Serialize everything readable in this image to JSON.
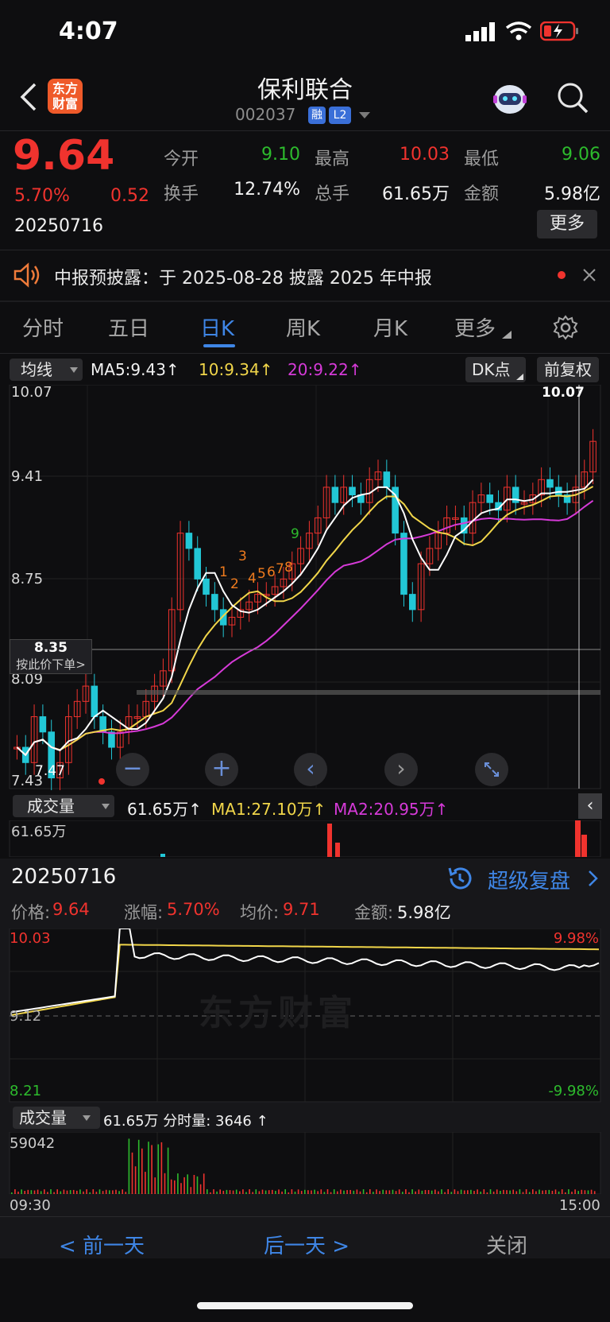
{
  "status": {
    "time": "4:07"
  },
  "header": {
    "title": "保利联合",
    "code": "002037",
    "tag_rong": "融",
    "tag_l2": "L2",
    "logo_line1": "东方",
    "logo_line2": "财富"
  },
  "quote": {
    "price": "9.64",
    "change_pct": "5.70%",
    "change": "0.52",
    "date": "20250716",
    "open_label": "今开",
    "open": "9.10",
    "high_label": "最高",
    "high": "10.03",
    "low_label": "最低",
    "low": "9.06",
    "turnover_label": "换手",
    "turnover": "12.74%",
    "volume_label": "总手",
    "volume": "61.65万",
    "amount_label": "金额",
    "amount": "5.98亿",
    "more_button": "更多"
  },
  "notice": {
    "text": "中报预披露：于 2025-08-28 披露 2025 年中报"
  },
  "tabs": [
    {
      "label": "分时"
    },
    {
      "label": "五日"
    },
    {
      "label": "日K"
    },
    {
      "label": "周K"
    },
    {
      "label": "月K"
    },
    {
      "label": "更多"
    }
  ],
  "kline": {
    "indicator": "均线",
    "ma5": "MA5:9.43↑",
    "ma10": "10:9.34↑",
    "ma20": "20:9.22↑",
    "dk": "DK点",
    "adjust": "前复权",
    "axis": [
      "10.07",
      "9.41",
      "8.75",
      "8.09",
      "7.43"
    ],
    "high_marker": "10.07",
    "low_marker": "7.47",
    "order_price": "8.35",
    "order_hint": "按此价下单>",
    "signals": [
      "1",
      "2",
      "3",
      "4",
      "5",
      "6",
      "7",
      "8",
      "9"
    ]
  },
  "volume": {
    "label": "成交量",
    "value": "61.65万↑",
    "ma1": "MA1:27.10万↑",
    "ma2": "MA2:20.95万↑",
    "axis_top": "61.65万"
  },
  "replay": {
    "date": "20250716",
    "link": "超级复盘",
    "price_label": "价格:",
    "price": "9.64",
    "pct_label": "涨幅:",
    "pct": "5.70%",
    "avg_label": "均价:",
    "avg": "9.71",
    "amount_label": "金额:",
    "amount": "5.98亿"
  },
  "intraday": {
    "axis_high": "10.03",
    "axis_mid": "9.12",
    "axis_low": "8.21",
    "pct_high": "9.98%",
    "pct_low": "-9.98%",
    "watermark": "东方财富",
    "vol_label": "成交量",
    "vol_text": "61.65万 分时量: 3646 ↑",
    "vol_axis": "59042",
    "time_start": "09:30",
    "time_end": "15:00"
  },
  "footer": {
    "prev": "< 前一天",
    "next": "后一天 >",
    "close": "关闭"
  },
  "colors": {
    "up": "#f0332e",
    "down": "#22c7d6",
    "ma5": "#ffffff",
    "ma10": "#f1d64a",
    "ma20": "#d63ad8",
    "accent": "#3f86e6"
  }
}
